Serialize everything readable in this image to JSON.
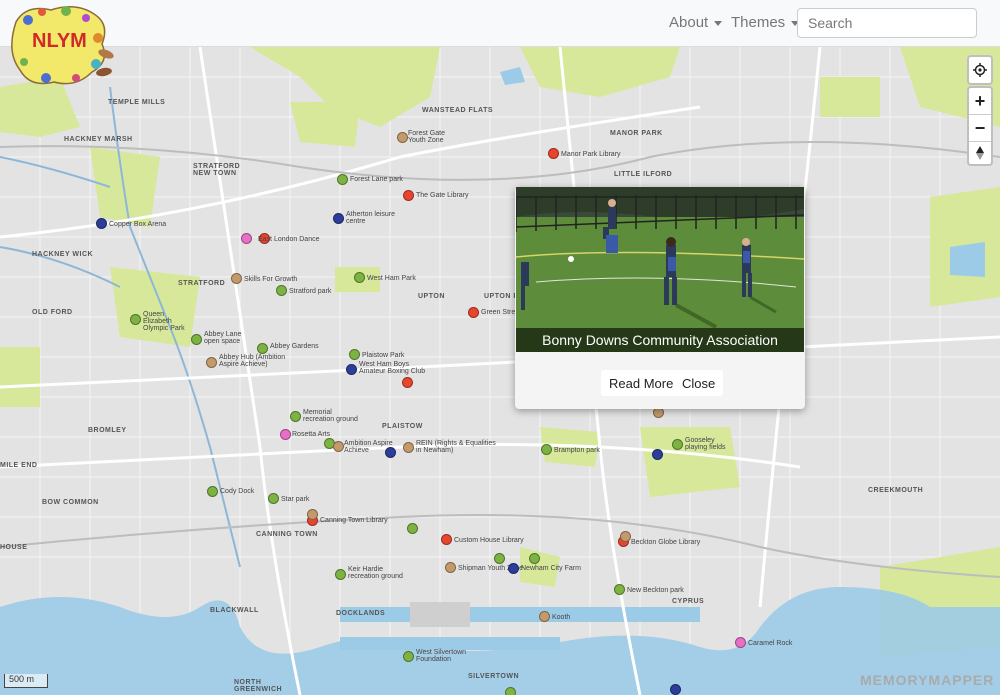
{
  "navbar": {
    "logo_text": "NLYM",
    "menu_about": "About",
    "menu_themes": "Themes",
    "search_placeholder": "Search"
  },
  "map_controls": {
    "zoom_in": "+",
    "zoom_out": "−"
  },
  "popup": {
    "title": "Bonny Downs Community Association",
    "read_more": "Read More",
    "close": "Close"
  },
  "area_labels": [
    "TEMPLE MILLS",
    "HACKNEY MARSH",
    "STRATFORD NEW TOWN",
    "WANSTEAD FLATS",
    "MANOR PARK",
    "LITTLE ILFORD",
    "HACKNEY WICK",
    "STRATFORD",
    "UPTON",
    "UPTON PARK",
    "OLD FORD",
    "PLAISTOW",
    "BROMLEY",
    "MILE END",
    "BOW COMMON",
    "CANNING TOWN",
    "BLACKWALL",
    "DOCKLANDS",
    "CYPRUS",
    "CREEKMOUTH",
    "SILVERTOWN",
    "NORTH GREENWICH",
    "HOUSE"
  ],
  "places": [
    {
      "label": "Forest Gate Youth Zone",
      "color": "#c49a6c"
    },
    {
      "label": "Manor Park Library",
      "color": "#e8452e"
    },
    {
      "label": "Forest Lane park",
      "color": "#7cb342"
    },
    {
      "label": "The Gate Library",
      "color": "#e8452e"
    },
    {
      "label": "Atherton leisure centre",
      "color": "#2c3e9a"
    },
    {
      "label": "Copper Box Arena",
      "color": "#2c3e9a"
    },
    {
      "label": "East London Dance",
      "color": "#e8452e"
    },
    {
      "label": "Skills For Growth",
      "color": "#c49a6c"
    },
    {
      "label": "West Ham Park",
      "color": "#7cb342"
    },
    {
      "label": "Stratford park",
      "color": "#7cb342"
    },
    {
      "label": "Queen Elizabeth Olympic Park",
      "color": "#7cb342"
    },
    {
      "label": "Green Street",
      "color": "#e8452e"
    },
    {
      "label": "Abbey Lane open space",
      "color": "#7cb342"
    },
    {
      "label": "Abbey Gardens",
      "color": "#7cb342"
    },
    {
      "label": "Abbey Hub (Ambition Aspire Achieve)",
      "color": "#c49a6c"
    },
    {
      "label": "Plaistow Park",
      "color": "#7cb342"
    },
    {
      "label": "West Ham Boys Amateur Boxing Club",
      "color": "#2c3e9a"
    },
    {
      "label": "Memorial recreation ground",
      "color": "#7cb342"
    },
    {
      "label": "Rosetta Arts",
      "color": "#e86fc6"
    },
    {
      "label": "Ambition Aspire Achieve",
      "color": "#c49a6c"
    },
    {
      "label": "REIN (Rights & Equalities in Newham)",
      "color": "#c49a6c"
    },
    {
      "label": "Brampton park",
      "color": "#7cb342"
    },
    {
      "label": "Gooseley playing fields",
      "color": "#7cb342"
    },
    {
      "label": "Bonny Downs Community Association",
      "color": "#c49a6c"
    },
    {
      "label": "Cody Dock",
      "color": "#7cb342"
    },
    {
      "label": "Star park",
      "color": "#7cb342"
    },
    {
      "label": "Canning Town Library",
      "color": "#e8452e"
    },
    {
      "label": "Custom House Library",
      "color": "#e8452e"
    },
    {
      "label": "Beckton Globe Library",
      "color": "#e8452e"
    },
    {
      "label": "Shipman Youth Zone",
      "color": "#c49a6c"
    },
    {
      "label": "Newham City Farm",
      "color": "#7cb342"
    },
    {
      "label": "Keir Hardie recreation ground",
      "color": "#7cb342"
    },
    {
      "label": "New Beckton park",
      "color": "#7cb342"
    },
    {
      "label": "Kooth",
      "color": "#c49a6c"
    },
    {
      "label": "Caramel Rock",
      "color": "#e86fc6"
    },
    {
      "label": "West Silvertown Foundation",
      "color": "#7cb342"
    }
  ],
  "scale_label": "500 m",
  "watermark": "MEMORYMAPPER"
}
